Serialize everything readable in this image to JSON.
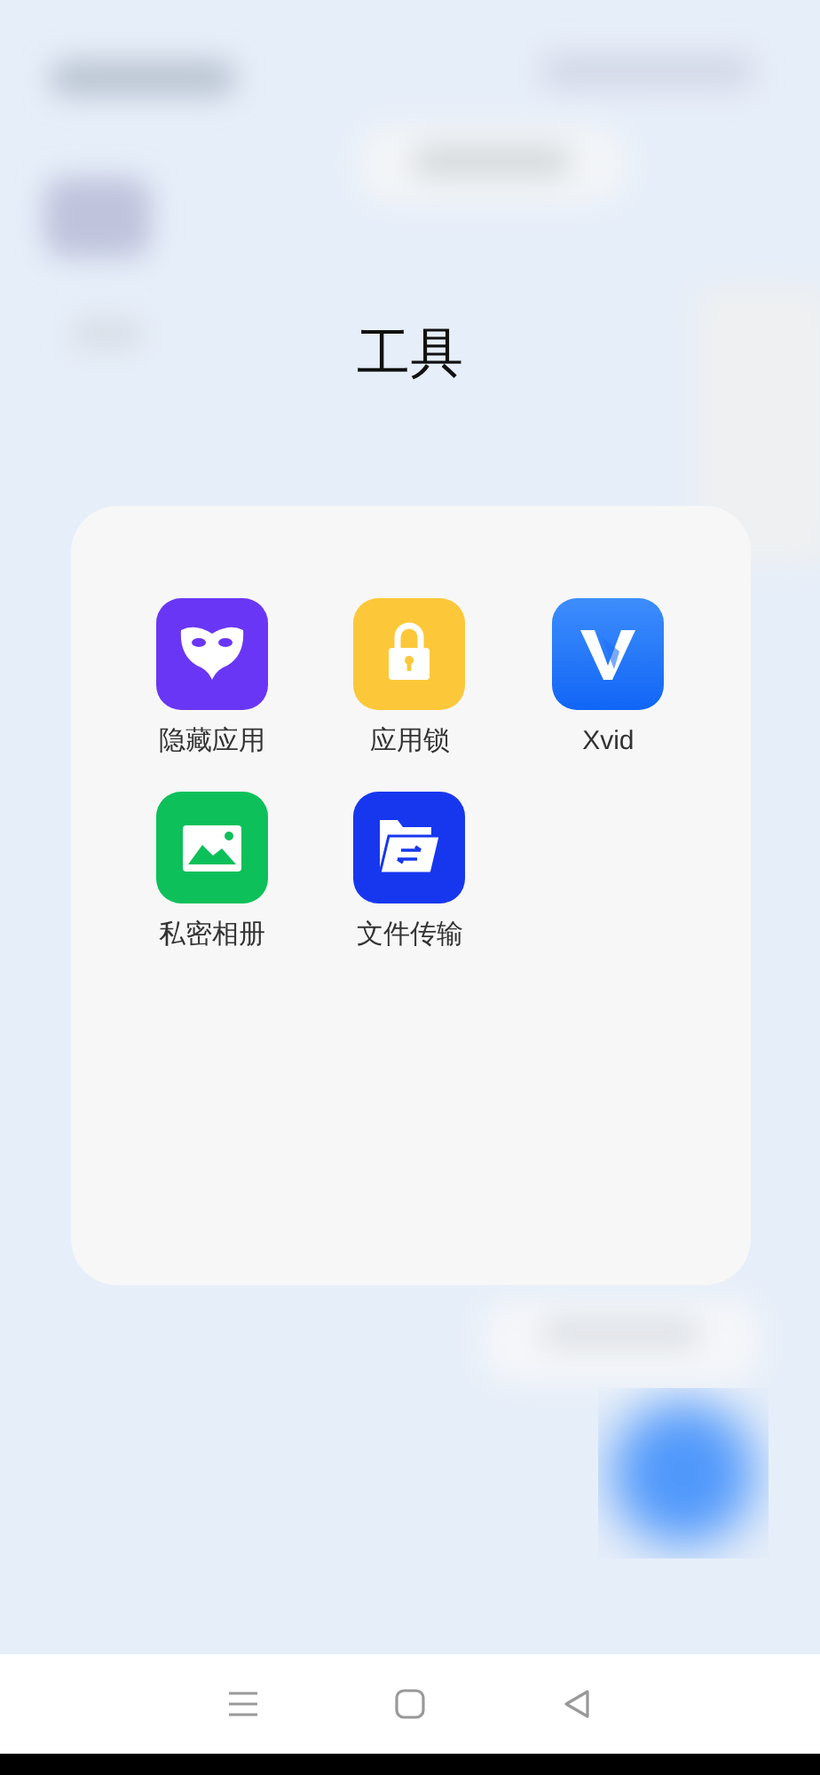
{
  "folder": {
    "title": "工具",
    "apps": [
      {
        "label": "隐藏应用",
        "kind": "mask"
      },
      {
        "label": "应用锁",
        "kind": "lock"
      },
      {
        "label": "Xvid",
        "kind": "xvid"
      },
      {
        "label": "私密相册",
        "kind": "gallery"
      },
      {
        "label": "文件传输",
        "kind": "transfer"
      }
    ]
  },
  "nav_bar": {
    "buttons": [
      {
        "kind": "menu"
      },
      {
        "kind": "home"
      },
      {
        "kind": "back"
      }
    ]
  }
}
